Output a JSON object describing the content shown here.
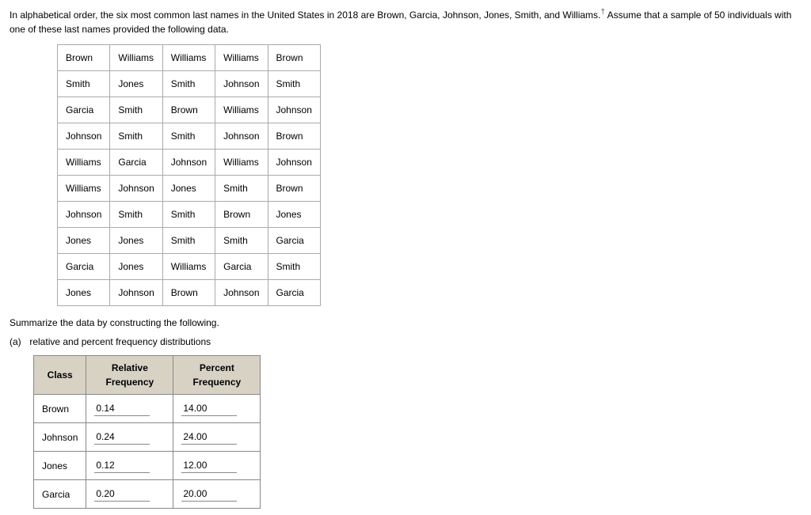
{
  "intro_text": "In alphabetical order, the six most common last names in the United States in 2018 are Brown, Garcia, Johnson, Jones, Smith, and Williams.",
  "intro_after": " Assume that a sample of 50 individuals with one of these last names provided the following data.",
  "dagger": "†",
  "sample_rows": [
    [
      "Brown",
      "Williams",
      "Williams",
      "Williams",
      "Brown"
    ],
    [
      "Smith",
      "Jones",
      "Smith",
      "Johnson",
      "Smith"
    ],
    [
      "Garcia",
      "Smith",
      "Brown",
      "Williams",
      "Johnson"
    ],
    [
      "Johnson",
      "Smith",
      "Smith",
      "Johnson",
      "Brown"
    ],
    [
      "Williams",
      "Garcia",
      "Johnson",
      "Williams",
      "Johnson"
    ],
    [
      "Williams",
      "Johnson",
      "Jones",
      "Smith",
      "Brown"
    ],
    [
      "Johnson",
      "Smith",
      "Smith",
      "Brown",
      "Jones"
    ],
    [
      "Jones",
      "Jones",
      "Smith",
      "Smith",
      "Garcia"
    ],
    [
      "Garcia",
      "Jones",
      "Williams",
      "Garcia",
      "Smith"
    ],
    [
      "Jones",
      "Johnson",
      "Brown",
      "Johnson",
      "Garcia"
    ]
  ],
  "summary_instruction": "Summarize the data by constructing the following.",
  "part_a_label": "(a)",
  "part_a_text": "relative and percent frequency distributions",
  "freq_headers": {
    "class": "Class",
    "rel": "Relative\nFrequency",
    "pct": "Percent\nFrequency"
  },
  "freq_rows": [
    {
      "class": "Brown",
      "rel": "0.14",
      "pct": "14.00"
    },
    {
      "class": "Johnson",
      "rel": "0.24",
      "pct": "24.00"
    },
    {
      "class": "Jones",
      "rel": "0.12",
      "pct": "12.00"
    },
    {
      "class": "Garcia",
      "rel": "0.20",
      "pct": "20.00"
    }
  ]
}
